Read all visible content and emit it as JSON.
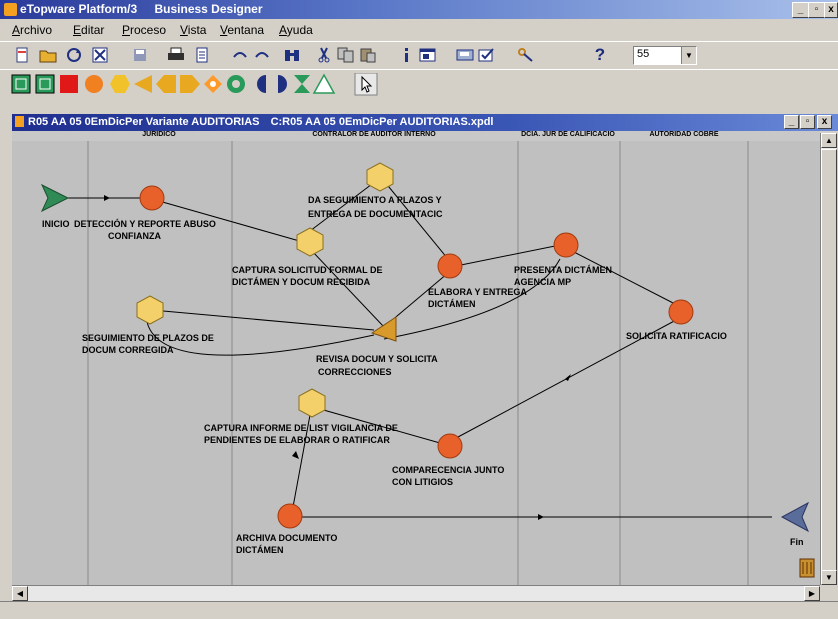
{
  "app": {
    "title_app": "eTopware Platform/3",
    "title_module": "Business Designer"
  },
  "menu": [
    "Archivo",
    "Editar",
    "Proceso",
    "Vista",
    "Ventana",
    "Ayuda"
  ],
  "toolbar": {
    "zoom_value": "55",
    "icons": [
      "new-icon",
      "open-icon",
      "refresh-icon",
      "close-doc-icon",
      "save-icon",
      "print-icon",
      "properties-icon",
      "undo-icon",
      "redo-icon",
      "binoculars-icon",
      "cut-icon",
      "copy-icon",
      "paste-icon",
      "info-icon",
      "window-icon",
      "save-as-icon",
      "check-icon",
      "key-icon",
      "help-icon"
    ]
  },
  "shape_palette": [
    "square-shape-icon",
    "square-alt-shape-icon",
    "red-square-shape-icon",
    "circle-shape-icon",
    "hexagon-shape-icon",
    "triangle-left-shape-icon",
    "pentagon-left-shape-icon",
    "arrow-right-shape-icon",
    "diamond-shape-icon",
    "ring-shape-icon",
    "half-moon-left-shape-icon",
    "half-moon-right-shape-icon",
    "hourglass-shape-icon",
    "triangle-shape-icon",
    "pointer-icon"
  ],
  "document": {
    "title_left": "R05  AA  05  0EmDicPer  Variante AUDITORIAS",
    "title_right": "C:R05  AA  05  0EmDicPer  AUDITORIAS.xpdl"
  },
  "lanes": [
    {
      "label": "JURIDICO"
    },
    {
      "label": "CONTRALOR DE AUDITOR INTERNO"
    },
    {
      "label": "DCIA. JUR DE CALIFICACIO"
    },
    {
      "label": "AUTORIDAD COBRE"
    }
  ],
  "nodes": {
    "inicio": "INICIO",
    "deteccion": "DETECCIÓN Y REPORTE ABUSO",
    "deteccion2": "CONFIANZA",
    "da_seguimiento": "DA SEGUIMIENTO A PLAZOS Y",
    "da_seguimiento2": "ENTREGA DE DOCUMENTACIC",
    "captura_solicitud": "CAPTURA SOLICITUD FORMAL DE",
    "captura_solicitud2": "DICTÁMEN Y DOCUM RECIBIDA",
    "elabora": "ELABORA Y ENTREGA",
    "elabora2": "DICTÁMEN",
    "presenta": "PRESENTA DICTÁMEN",
    "presenta2": "AGENCIA MP",
    "solicita": "SOLICITA RATIFICACIO",
    "seguimiento_plazos": "SEGUIMIENTO DE PLAZOS DE",
    "seguimiento_plazos2": "DOCUM CORREGIDA",
    "revisa": "REVISA DOCUM Y SOLICITA",
    "revisa2": "CORRECCIONES",
    "captura_informe": "CAPTURA INFORME DE LIST VIGILANCIA DE",
    "captura_informe2": "PENDIENTES DE ELABORAR O RATIFICAR",
    "comparecencia": "COMPARECENCIA JUNTO",
    "comparecencia2": "CON LITIGIOS",
    "archiva": "ARCHIVA DOCUMENTO",
    "archiva2": "DICTÁMEN",
    "fin": "Fin"
  },
  "colors": {
    "activity_orange": "#e8612a",
    "activity_yellow": "#f3d06a",
    "start_green": "#2f8a56",
    "end_blue": "#5a6c9a",
    "decision_yellow": "#d89a2a"
  }
}
